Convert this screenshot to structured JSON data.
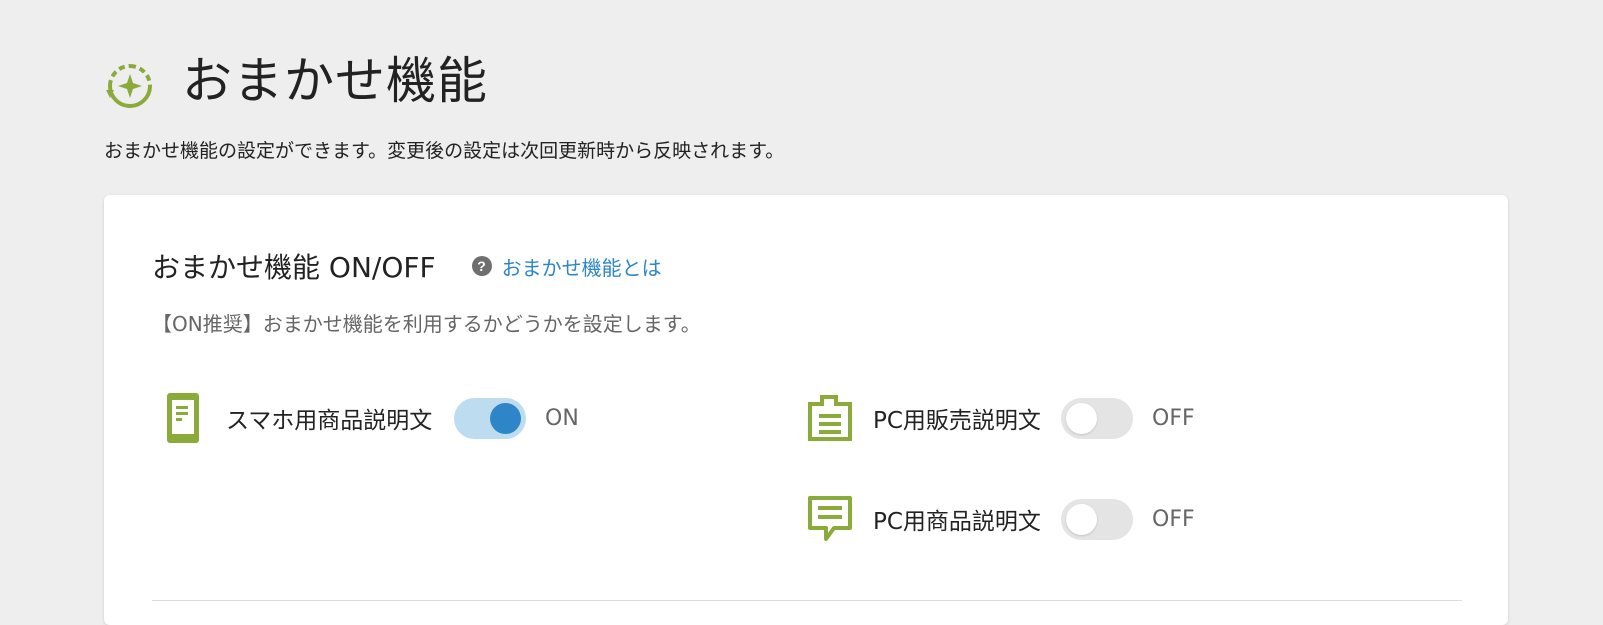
{
  "header": {
    "title": "おまかせ機能",
    "description": "おまかせ機能の設定ができます。変更後の設定は次回更新時から反映されます。"
  },
  "section": {
    "title": "おまかせ機能 ON/OFF",
    "help_link": "おまかせ機能とは",
    "description": "【ON推奨】おまかせ機能を利用するかどうかを設定します。"
  },
  "settings": [
    {
      "label": "スマホ用商品説明文",
      "state": "ON",
      "icon": "smartphone-doc-icon"
    },
    {
      "label": "PC用販売説明文",
      "state": "OFF",
      "icon": "sales-doc-icon"
    },
    {
      "label": "PC用商品説明文",
      "state": "OFF",
      "icon": "comment-doc-icon"
    }
  ],
  "colors": {
    "accent_green": "#8aab3a",
    "link_blue": "#2e86c8",
    "toggle_on_track": "#bddcef",
    "toggle_on_knob": "#2e86c8",
    "toggle_off_track": "#e4e4e4",
    "background": "#eeeeee"
  }
}
